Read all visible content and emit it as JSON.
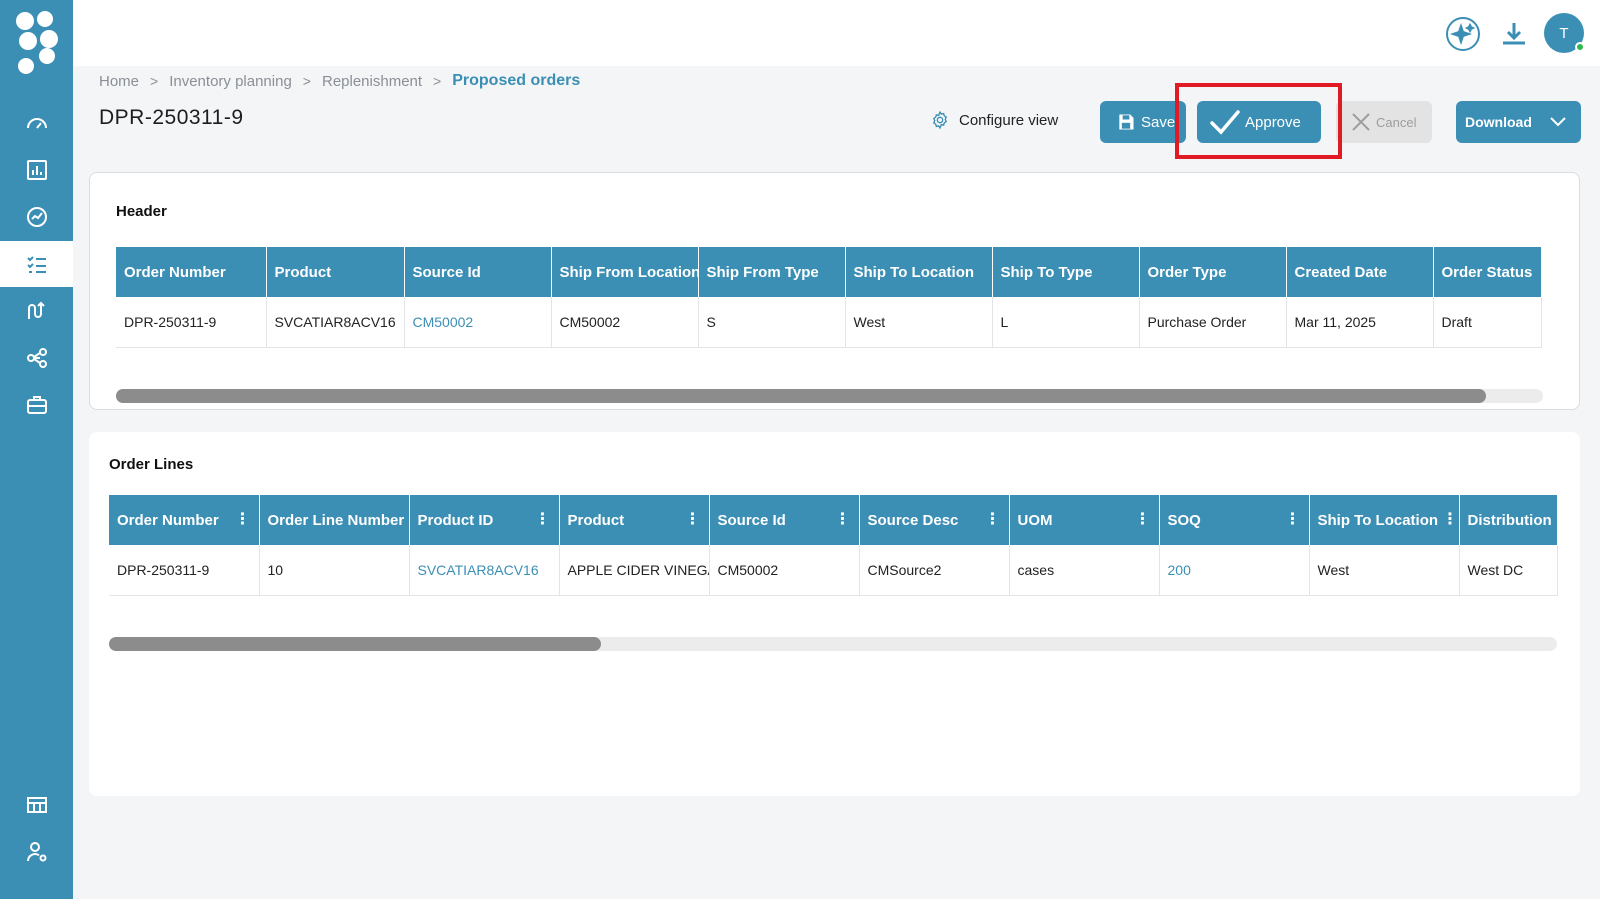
{
  "colors": {
    "primary": "#3b8fb5",
    "highlight": "#e01b24",
    "online": "#2eb84b"
  },
  "sidebar": {
    "logo": "app-logo",
    "items": [
      {
        "icon": "speedometer-icon",
        "active": false
      },
      {
        "icon": "bar-chart-icon",
        "active": false
      },
      {
        "icon": "trend-line-icon",
        "active": false
      },
      {
        "icon": "checklist-icon",
        "active": true
      },
      {
        "icon": "route-icon",
        "active": false
      },
      {
        "icon": "network-icon",
        "active": false
      },
      {
        "icon": "briefcase-icon",
        "active": false
      },
      {
        "icon": "dashboard-grid-icon",
        "active": false
      },
      {
        "icon": "user-settings-icon",
        "active": false
      }
    ]
  },
  "topbar": {
    "ai_icon": "sparkle-icon",
    "download_icon": "download-icon",
    "avatar_initial": "T"
  },
  "breadcrumb": {
    "items": [
      "Home",
      "Inventory planning",
      "Replenishment"
    ],
    "current": "Proposed orders"
  },
  "page": {
    "title": "DPR-250311-9"
  },
  "toolbar": {
    "configure_label": "Configure view",
    "save_label": "Save",
    "approve_label": "Approve",
    "cancel_label": "Cancel",
    "download_label": "Download"
  },
  "header_section": {
    "title": "Header",
    "columns": [
      "Order Number",
      "Product",
      "Source Id",
      "Ship From Location",
      "Ship From Type",
      "Ship To Location",
      "Ship To Type",
      "Order Type",
      "Created Date",
      "Order Status"
    ],
    "row": [
      "DPR-250311-9",
      "SVCATIAR8ACV16",
      "CM50002",
      "CM50002",
      "S",
      "West",
      "L",
      "Purchase Order",
      "Mar 11, 2025",
      "Draft"
    ],
    "scroll_fraction": 0.96
  },
  "lines_section": {
    "title": "Order Lines",
    "columns": [
      "Order Number",
      "Order Line Number",
      "Product ID",
      "Product",
      "Source Id",
      "Source Desc",
      "UOM",
      "SOQ",
      "Ship To Location",
      "Distribution"
    ],
    "row": [
      "DPR-250311-9",
      "10",
      "SVCATIAR8ACV16",
      "APPLE CIDER VINEGAR",
      "CM50002",
      "CMSource2",
      "cases",
      "200",
      "West",
      "West DC"
    ],
    "scroll_fraction": 0.34
  }
}
